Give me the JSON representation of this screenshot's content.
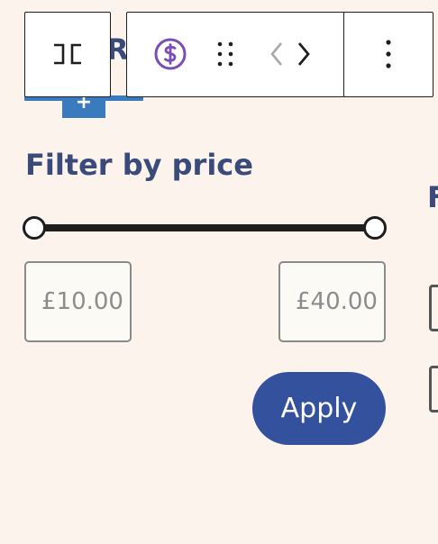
{
  "toolbar": {
    "transform_icon": "block-type-icon",
    "price_icon": "currency-dollar-icon",
    "drag_icon": "drag-handle-icon",
    "move_prev_icon": "chevron-left-icon",
    "move_next_icon": "chevron-right-icon",
    "options_icon": "more-vertical-icon"
  },
  "hidden_heading": {
    "text": "R"
  },
  "add_button": {
    "label": "+"
  },
  "filter": {
    "title": "Filter by price",
    "min_value": "£10.00",
    "max_value": "£40.00",
    "apply_label": "Apply"
  },
  "right_column": {
    "partial_heading": "F"
  },
  "colors": {
    "background": "#fbf3ec",
    "heading": "#3a4a7a",
    "apply_button": "#34519e",
    "price_icon": "#7a4fb5",
    "add_button": "#3a7bbf"
  }
}
